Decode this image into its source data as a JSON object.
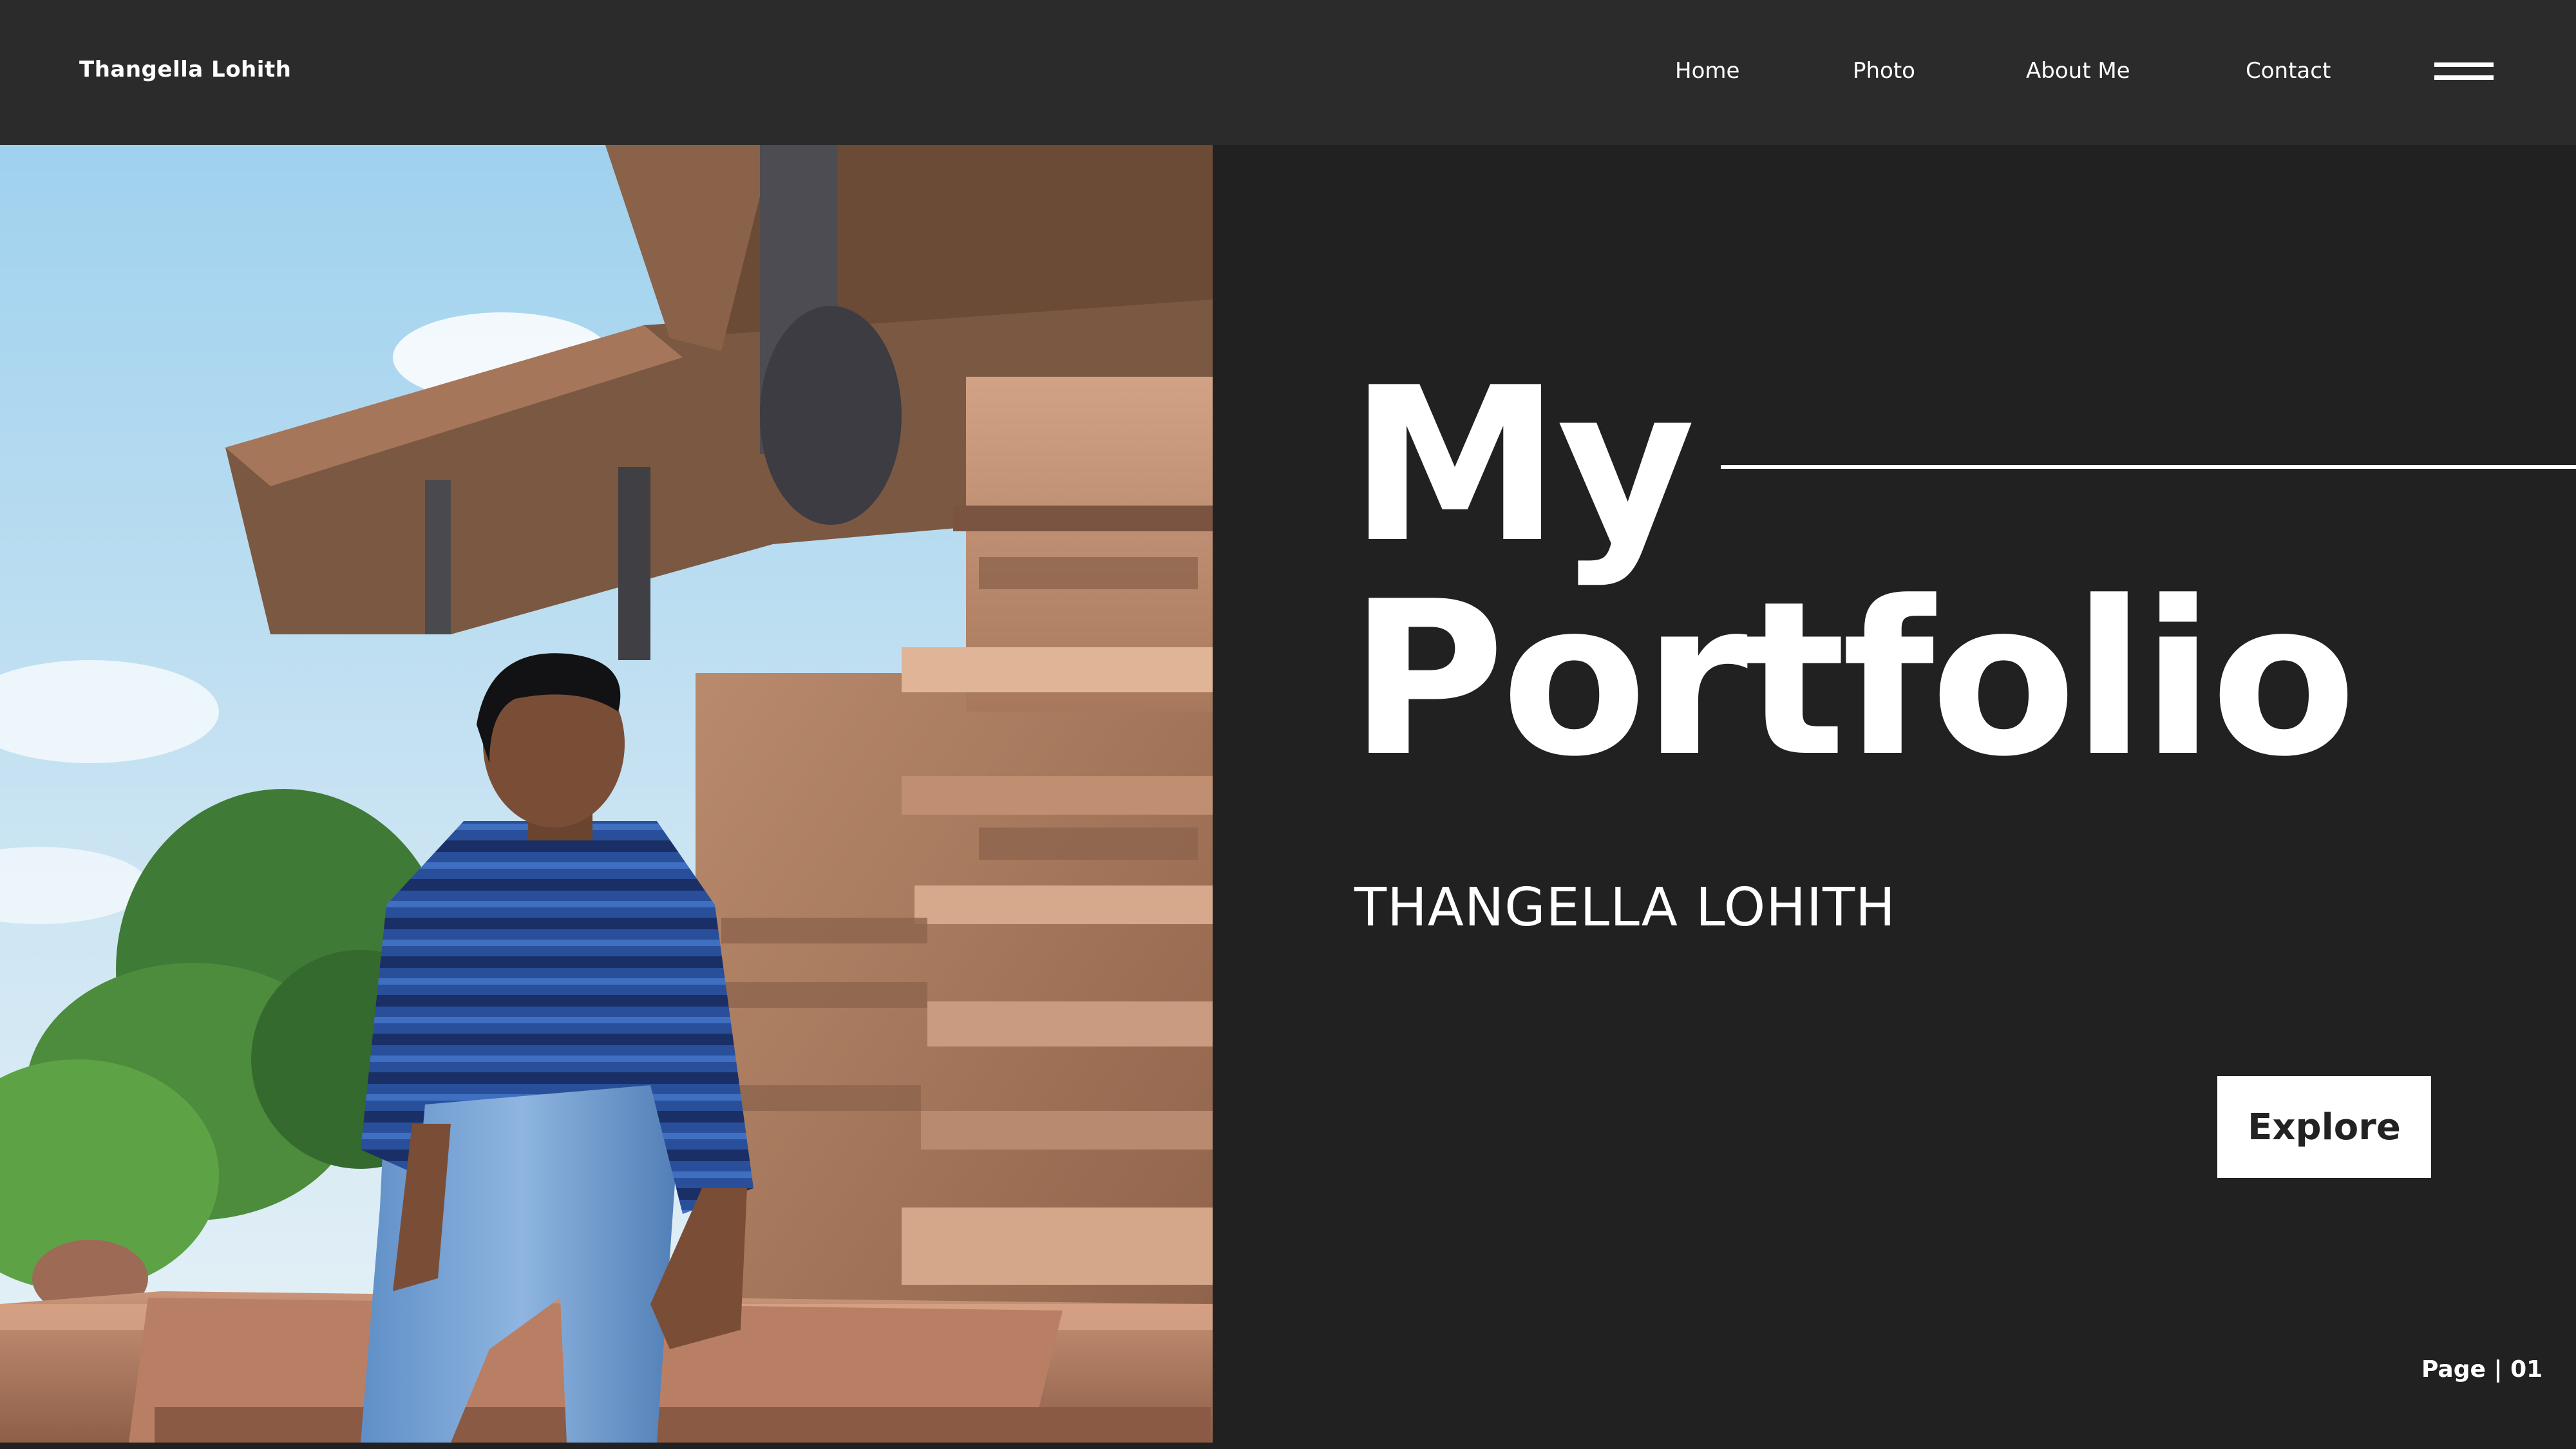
{
  "header": {
    "brand": "Thangella Lohith",
    "nav": [
      {
        "label": "Home"
      },
      {
        "label": "Photo"
      },
      {
        "label": "About Me"
      },
      {
        "label": "Contact"
      }
    ],
    "menu_icon": "hamburger-menu-icon"
  },
  "hero": {
    "title_line1": "My",
    "title_line2": "Portfolio",
    "subtitle": "THANGELLA LOHITH",
    "cta_label": "Explore"
  },
  "footer": {
    "page_label": "Page | 01"
  },
  "colors": {
    "background": "#212121",
    "header_background": "#2b2b2b",
    "text": "#ffffff",
    "button_background": "#ffffff",
    "button_text": "#222222"
  }
}
